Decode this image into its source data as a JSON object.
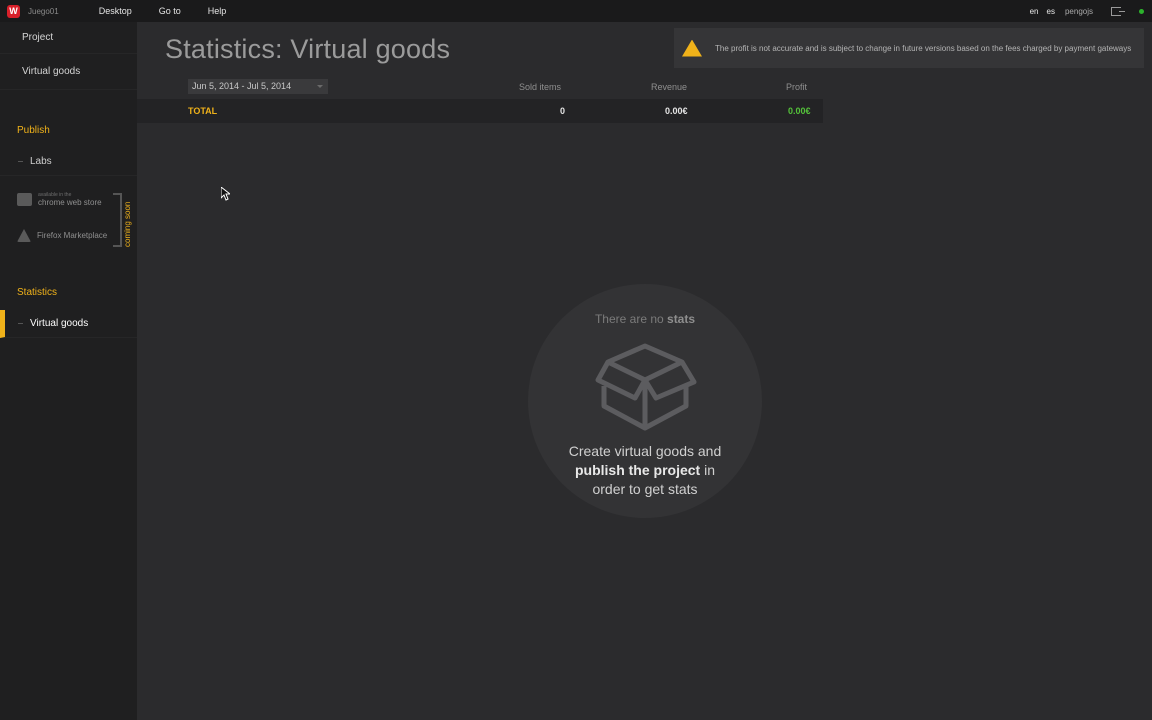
{
  "topbar": {
    "logo_letter": "W",
    "project_name": "Juego01",
    "nav": [
      "Desktop",
      "Go to",
      "Help"
    ],
    "languages": [
      "en",
      "es"
    ],
    "user": "pengojs",
    "status_color": "#2cb32c"
  },
  "sidebar": {
    "project": "Project",
    "virtual_goods": "Virtual goods",
    "publish_section": "Publish",
    "labs": "Labs",
    "chrome_small": "available in the",
    "chrome_store": "chrome web store",
    "firefox_store": "Firefox Marketplace",
    "coming_soon": "coming soon",
    "statistics_section": "Statistics",
    "statistics_item": "Virtual goods",
    "accent_color": "#f0b21a"
  },
  "main": {
    "title": "Statistics: Virtual goods",
    "warning_text": "The profit is not accurate and is subject to change in future versions based on the fees charged by payment gateways",
    "table": {
      "date_range": "Jun 5, 2014 - Jul 5, 2014",
      "headers": {
        "sold": "Sold items",
        "revenue": "Revenue",
        "profit": "Profit"
      },
      "total_row": {
        "label": "TOTAL",
        "sold": "0",
        "revenue": "0.00€",
        "profit": "0.00€"
      }
    },
    "empty_state": {
      "top_prefix": "There are no ",
      "top_bold": "stats",
      "line1": "Create virtual goods and",
      "bold": "publish the project",
      "after_bold": " in",
      "line3": "order to get stats",
      "icon": "box-icon"
    }
  }
}
